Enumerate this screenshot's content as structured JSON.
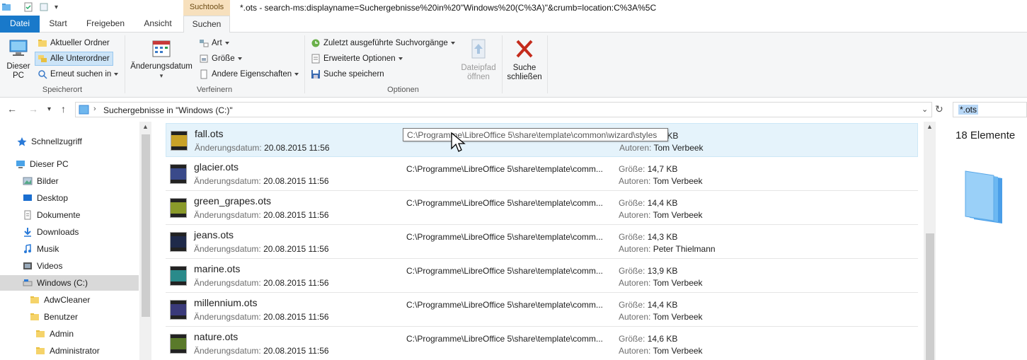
{
  "window": {
    "title": "*.ots - search-ms:displayname=Suchergebnisse%20in%20\"Windows%20(C%3A)\"&crumb=location:C%3A%5C",
    "context_tab": "Suchtools"
  },
  "tabs": [
    "Datei",
    "Start",
    "Freigeben",
    "Ansicht",
    "Suchen"
  ],
  "ribbon": {
    "speicherort": {
      "label": "Speicherort",
      "dieser_pc": "Dieser PC",
      "aktueller_ordner": "Aktueller Ordner",
      "alle_unterordner": "Alle Unterordner",
      "erneut_suchen": "Erneut suchen in"
    },
    "verfeinern": {
      "label": "Verfeinern",
      "aenderungsdatum": "Änderungsdatum",
      "art": "Art",
      "groesse": "Größe",
      "andere": "Andere Eigenschaften"
    },
    "optionen": {
      "label": "Optionen",
      "zuletzt": "Zuletzt ausgeführte Suchvorgänge",
      "erweitert": "Erweiterte Optionen",
      "speichern": "Suche speichern",
      "dateipfad_1": "Dateipfad",
      "dateipfad_2": "öffnen"
    },
    "schliessen": {
      "line1": "Suche",
      "line2": "schließen"
    }
  },
  "address": {
    "breadcrumb": "Suchergebnisse in \"Windows (C:)\"",
    "search_value": "*.ots"
  },
  "nav": [
    {
      "label": "Schnellzugriff",
      "icon": "star-icon"
    },
    {
      "label": "Dieser PC",
      "icon": "computer-icon"
    },
    {
      "label": "Bilder",
      "icon": "pictures-icon"
    },
    {
      "label": "Desktop",
      "icon": "desktop-icon"
    },
    {
      "label": "Dokumente",
      "icon": "documents-icon"
    },
    {
      "label": "Downloads",
      "icon": "downloads-icon"
    },
    {
      "label": "Musik",
      "icon": "music-icon"
    },
    {
      "label": "Videos",
      "icon": "videos-icon"
    },
    {
      "label": "Windows (C:)",
      "icon": "drive-icon"
    },
    {
      "label": "AdwCleaner",
      "icon": "folder-icon"
    },
    {
      "label": "Benutzer",
      "icon": "folder-icon"
    },
    {
      "label": "Admin",
      "icon": "folder-icon"
    },
    {
      "label": "Administrator",
      "icon": "folder-icon"
    }
  ],
  "labels": {
    "date": "Änderungsdatum:",
    "size": "Größe:",
    "author": "Autoren:"
  },
  "files": [
    {
      "name": "fall.ots",
      "date": "20.08.2015 11:56",
      "path": "C:\\Programme\\LibreOffice 5\\share\\template\\comm...",
      "size": "14,6 KB",
      "author": "Tom Verbeek",
      "color": "#c9a227"
    },
    {
      "name": "glacier.ots",
      "date": "20.08.2015 11:56",
      "path": "C:\\Programme\\LibreOffice 5\\share\\template\\comm...",
      "size": "14,7 KB",
      "author": "Tom Verbeek",
      "color": "#3a4a8a"
    },
    {
      "name": "green_grapes.ots",
      "date": "20.08.2015 11:56",
      "path": "C:\\Programme\\LibreOffice 5\\share\\template\\comm...",
      "size": "14,4 KB",
      "author": "Tom Verbeek",
      "color": "#8a9a2a"
    },
    {
      "name": "jeans.ots",
      "date": "20.08.2015 11:56",
      "path": "C:\\Programme\\LibreOffice 5\\share\\template\\comm...",
      "size": "14,3 KB",
      "author": "Peter Thielmann",
      "color": "#1f2a4a"
    },
    {
      "name": "marine.ots",
      "date": "20.08.2015 11:56",
      "path": "C:\\Programme\\LibreOffice 5\\share\\template\\comm...",
      "size": "13,9 KB",
      "author": "Tom Verbeek",
      "color": "#2a8a8a"
    },
    {
      "name": "millennium.ots",
      "date": "20.08.2015 11:56",
      "path": "C:\\Programme\\LibreOffice 5\\share\\template\\comm...",
      "size": "14,4 KB",
      "author": "Tom Verbeek",
      "color": "#3a3a7a"
    },
    {
      "name": "nature.ots",
      "date": "20.08.2015 11:56",
      "path": "C:\\Programme\\LibreOffice 5\\share\\template\\comm...",
      "size": "14,6 KB",
      "author": "Tom Verbeek",
      "color": "#5a7a2a"
    }
  ],
  "tooltip": "C:\\Programme\\LibreOffice 5\\share\\template\\common\\wizard\\styles",
  "details": {
    "count": "18 Elemente"
  }
}
